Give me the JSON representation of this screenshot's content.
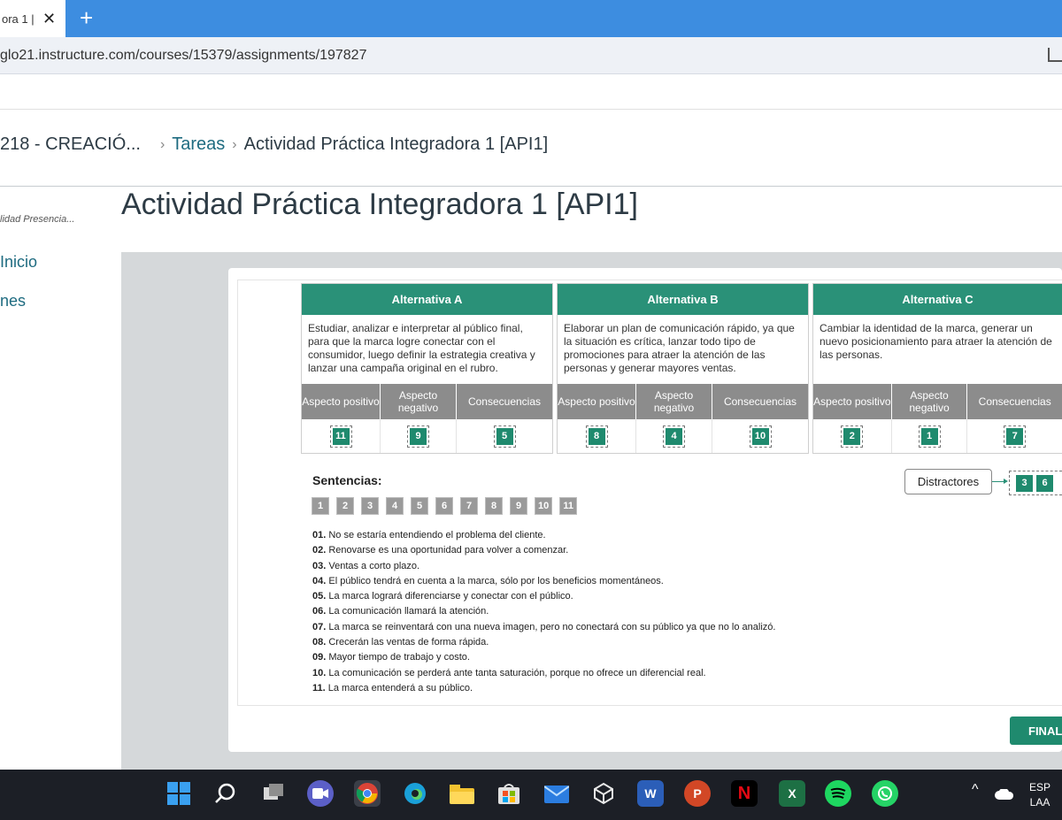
{
  "browser": {
    "tab_title": "ora 1 |",
    "tab_close": "✕",
    "new_tab": "+",
    "url": "glo21.instructure.com/courses/15379/assignments/197827"
  },
  "breadcrumb": {
    "course": "218 - CREACIÓ...",
    "sep": "›",
    "section": "Tareas",
    "current": "Actividad Práctica Integradora 1 [API1]"
  },
  "sidebar": {
    "subtitle": "lidad Presencia...",
    "items": [
      "Inicio",
      "nes"
    ]
  },
  "page_title": "Actividad Práctica Integradora 1 [API1]",
  "alternatives": [
    {
      "title": "Alternativa A",
      "description": "Estudiar, analizar e interpretar al público final, para que la marca logre conectar con el consumidor, luego definir la estrategia creativa y lanzar una campaña original en el rubro.",
      "cols": [
        "Aspecto positivo",
        "Aspecto negativo",
        "Consecuencias"
      ],
      "values": [
        "11",
        "9",
        "5"
      ]
    },
    {
      "title": "Alternativa B",
      "description": "Elaborar un plan de comunicación rápido, ya que la situación es crítica, lanzar todo tipo de promociones para atraer la atención de las personas y generar mayores ventas.",
      "cols": [
        "Aspecto positivo",
        "Aspecto negativo",
        "Consecuencias"
      ],
      "values": [
        "8",
        "4",
        "10"
      ]
    },
    {
      "title": "Alternativa C",
      "description": "Cambiar la identidad de la marca, generar un nuevo posicionamiento para atraer la atención de las personas.",
      "cols": [
        "Aspecto positivo",
        "Aspecto negativo",
        "Consecuencias"
      ],
      "values": [
        "2",
        "1",
        "7"
      ]
    }
  ],
  "sentences_title": "Sentencias:",
  "chips": [
    "1",
    "2",
    "3",
    "4",
    "5",
    "6",
    "7",
    "8",
    "9",
    "10",
    "11"
  ],
  "distractors": {
    "label": "Distractores",
    "values": [
      "3",
      "6"
    ]
  },
  "sentences": [
    {
      "num": "01.",
      "text": "No se estaría entendiendo el problema del cliente."
    },
    {
      "num": "02.",
      "text": "Renovarse es una oportunidad para volver a comenzar."
    },
    {
      "num": "03.",
      "text": "Ventas a corto plazo."
    },
    {
      "num": "04.",
      "text": "El público tendrá en cuenta a la marca, sólo por los beneficios momentáneos."
    },
    {
      "num": "05.",
      "text": "La marca logrará diferenciarse y conectar con el público."
    },
    {
      "num": "06.",
      "text": "La comunicación llamará la atención."
    },
    {
      "num": "07.",
      "text": "La marca se reinventará con una nueva imagen, pero no conectará con su público ya que no lo analizó."
    },
    {
      "num": "08.",
      "text": "Crecerán las ventas de forma rápida."
    },
    {
      "num": "09.",
      "text": "Mayor tiempo de trabajo y costo."
    },
    {
      "num": "10.",
      "text": "La comunicación se perderá ante tanta saturación, porque no ofrece un diferencial real."
    },
    {
      "num": "11.",
      "text": "La marca entenderá a su público."
    }
  ],
  "final_button": "FINAL",
  "taskbar": {
    "lang_top": "ESP",
    "lang_bottom": "LAA",
    "tray_chevron": "^",
    "apps": [
      "windows-icon",
      "search-icon",
      "task-view-icon",
      "teams-icon",
      "chrome-icon",
      "edge-icon",
      "file-explorer-icon",
      "store-icon",
      "mail-icon",
      "app-icon",
      "word-icon",
      "powerpoint-icon",
      "netflix-icon",
      "excel-icon",
      "spotify-icon",
      "whatsapp-icon"
    ],
    "colors": {
      "windows": "#3aa0f0",
      "chrome": "#e0b030",
      "edge": "#1aa0d8",
      "explorer": "#f2c230",
      "store": "#2b7de0",
      "mail": "#2b7de0",
      "word": "#2b5eb8",
      "powerpoint": "#d24726",
      "netflix": "#000000",
      "excel": "#1d7044",
      "spotify": "#1ed760",
      "whatsapp": "#25d366"
    }
  }
}
